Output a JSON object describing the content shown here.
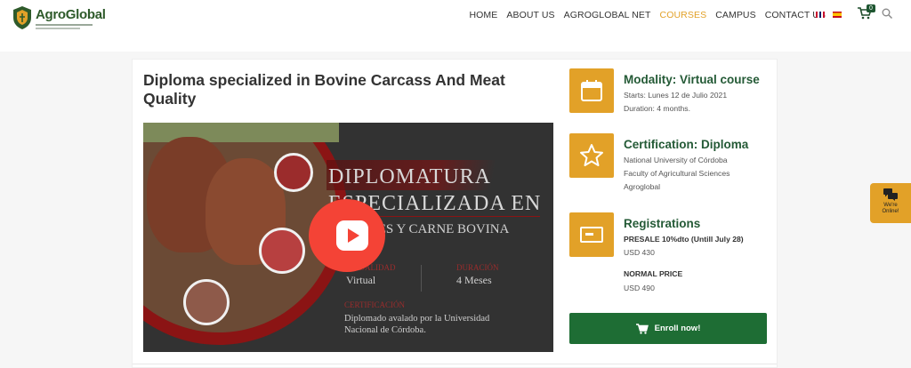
{
  "header": {
    "logo_text": "AgroGlobal",
    "nav": [
      {
        "label": "HOME",
        "active": false
      },
      {
        "label": "ABOUT US",
        "active": false
      },
      {
        "label": "AGROGLOBAL NET",
        "active": false
      },
      {
        "label": "COURSES",
        "active": true
      },
      {
        "label": "CAMPUS",
        "active": false
      },
      {
        "label": "CONTACT US",
        "active": false
      }
    ],
    "cart_count": "0",
    "icons": {
      "cart": "shopping-cart-icon",
      "search": "search-icon",
      "lang_en": "uk-flag-icon",
      "lang_es": "spain-flag-icon"
    }
  },
  "course": {
    "title": "Diploma specialized in Bovine Carcass And Meat Quality",
    "video": {
      "heading_line1": "DIPLOMATURA",
      "heading_line2": "ESPECIALIZADA EN",
      "subheading": "DE RES Y CARNE BOVINA",
      "modality_label": "MODALIDAD",
      "modality_value": "Virtual",
      "duration_label": "DURACIÓN",
      "duration_value": "4 Meses",
      "cert_label": "CERTIFICACIÓN",
      "cert_text": "Diplomado avalado por la Universidad Nacional de Córdoba."
    }
  },
  "info": {
    "modality": {
      "icon": "calendar-icon",
      "heading": "Modality: Virtual course",
      "starts": "Starts: Lunes 12 de Julio 2021",
      "duration": "Duration: 4 months."
    },
    "certification": {
      "icon": "star-icon",
      "heading": "Certification: Diploma",
      "line1": "National University of Córdoba",
      "line2": "Faculty of Agricultural Sciences",
      "line3": "Agroglobal"
    },
    "registrations": {
      "icon": "money-bill-icon",
      "heading": "Registrations",
      "presale_label": "PRESALE 10%dto (Untill July 28)",
      "presale_price": "USD 430",
      "normal_label": "NORMAL PRICE",
      "normal_price": "USD 490"
    }
  },
  "enroll_label": "Enroll now!",
  "chat": {
    "line1": "We're",
    "line2": "Online!"
  },
  "colors": {
    "accent": "#e2a128",
    "brand_green": "#1e6d34",
    "play_red": "#f44336"
  }
}
